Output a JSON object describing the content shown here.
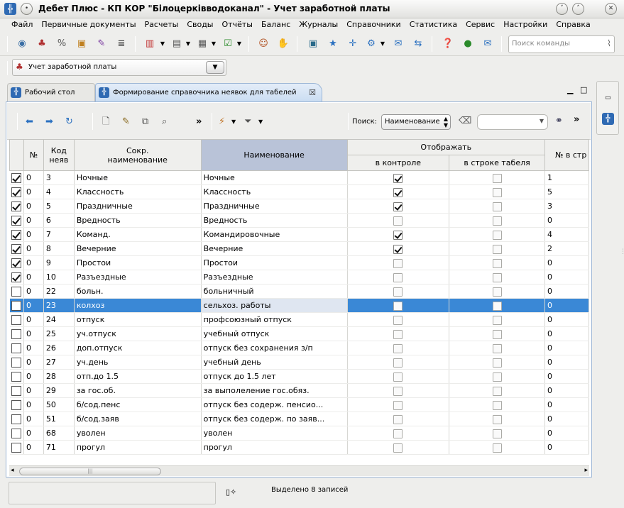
{
  "window": {
    "title": "Дебет Плюс - КП КОР \"Білоцерківводоканал\" - Учет заработной платы",
    "app_icon": "debet-plus-logo-icon"
  },
  "menu": [
    "Файл",
    "Первичные документы",
    "Расчеты",
    "Своды",
    "Отчёты",
    "Баланс",
    "Журналы",
    "Справочники",
    "Статистика",
    "Сервис",
    "Настройки",
    "Справка"
  ],
  "command_search": {
    "placeholder": "Поиск команды"
  },
  "module_selector": {
    "value": "Учет заработной платы"
  },
  "tabs": [
    {
      "label": "Рабочий стол",
      "active": false
    },
    {
      "label": "Формирование справочника неявок для табелей",
      "active": true
    }
  ],
  "editor_toolbar": {
    "search_label": "Поиск:",
    "search_field": "Наименование",
    "search_value": ""
  },
  "table": {
    "headers": {
      "num": "№",
      "code": "Код неяв",
      "short": "Сокр. наименование",
      "name": "Наименование",
      "display_group": "Отображать",
      "in_control": "в контроле",
      "in_timesheet": "в строке табеля",
      "line_num": "№ в стр"
    },
    "rows": [
      {
        "sel": true,
        "n": "0",
        "code": "3",
        "short": "Ночные",
        "name": "Ночные",
        "ctrl": true,
        "tab": false,
        "line": "1"
      },
      {
        "sel": true,
        "n": "0",
        "code": "4",
        "short": "Классность",
        "name": "Классность",
        "ctrl": true,
        "tab": false,
        "line": "5"
      },
      {
        "sel": true,
        "n": "0",
        "code": "5",
        "short": "Праздничные",
        "name": "Праздничные",
        "ctrl": true,
        "tab": false,
        "line": "3"
      },
      {
        "sel": true,
        "n": "0",
        "code": "6",
        "short": "Вредность",
        "name": "Вредность",
        "ctrl": false,
        "tab": false,
        "line": "0"
      },
      {
        "sel": true,
        "n": "0",
        "code": "7",
        "short": "Команд.",
        "name": "Командировочные",
        "ctrl": true,
        "tab": false,
        "line": "4"
      },
      {
        "sel": true,
        "n": "0",
        "code": "8",
        "short": "Вечерние",
        "name": "Вечерние",
        "ctrl": true,
        "tab": false,
        "line": "2"
      },
      {
        "sel": true,
        "n": "0",
        "code": "9",
        "short": "Простои",
        "name": "Простои",
        "ctrl": false,
        "tab": false,
        "line": "0"
      },
      {
        "sel": true,
        "n": "0",
        "code": "10",
        "short": "Разъездные",
        "name": "Разъездные",
        "ctrl": false,
        "tab": false,
        "line": "0"
      },
      {
        "sel": false,
        "n": "0",
        "code": "22",
        "short": "больн.",
        "name": "больничный",
        "ctrl": false,
        "tab": false,
        "line": "0"
      },
      {
        "sel": false,
        "n": "0",
        "code": "23",
        "short": "колхоз",
        "name": "сельхоз. работы",
        "ctrl": false,
        "tab": false,
        "line": "0",
        "highlight": true
      },
      {
        "sel": false,
        "n": "0",
        "code": "24",
        "short": "отпуск",
        "name": "профсоюзный отпуск",
        "ctrl": false,
        "tab": false,
        "line": "0"
      },
      {
        "sel": false,
        "n": "0",
        "code": "25",
        "short": "уч.отпуск",
        "name": "учебный отпуск",
        "ctrl": false,
        "tab": false,
        "line": "0"
      },
      {
        "sel": false,
        "n": "0",
        "code": "26",
        "short": "доп.отпуск",
        "name": "отпуск без сохранения з/п",
        "ctrl": false,
        "tab": false,
        "line": "0"
      },
      {
        "sel": false,
        "n": "0",
        "code": "27",
        "short": "уч.день",
        "name": "учебный день",
        "ctrl": false,
        "tab": false,
        "line": "0"
      },
      {
        "sel": false,
        "n": "0",
        "code": "28",
        "short": "отп.до 1.5",
        "name": "отпуск до 1.5 лет",
        "ctrl": false,
        "tab": false,
        "line": "0"
      },
      {
        "sel": false,
        "n": "0",
        "code": "29",
        "short": "за гос.об.",
        "name": "за выполеление гос.обяз.",
        "ctrl": false,
        "tab": false,
        "line": "0"
      },
      {
        "sel": false,
        "n": "0",
        "code": "50",
        "short": "б/сод.пенс",
        "name": "отпуск без содерж. пенсио...",
        "ctrl": false,
        "tab": false,
        "line": "0"
      },
      {
        "sel": false,
        "n": "0",
        "code": "51",
        "short": "б/сод.заяв",
        "name": "отпуск без содерж. по заяв...",
        "ctrl": false,
        "tab": false,
        "line": "0"
      },
      {
        "sel": false,
        "n": "0",
        "code": "68",
        "short": "уволен",
        "name": "уволен",
        "ctrl": false,
        "tab": false,
        "line": "0"
      },
      {
        "sel": false,
        "n": "0",
        "code": "71",
        "short": "прогул",
        "name": "прогул",
        "ctrl": false,
        "tab": false,
        "line": "0"
      }
    ]
  },
  "status": {
    "text": "Выделено 8 записей"
  },
  "colors": {
    "accent": "#3a88d6",
    "selected_header": "#b9c3d8",
    "tab_active": "#c9dcf2"
  }
}
